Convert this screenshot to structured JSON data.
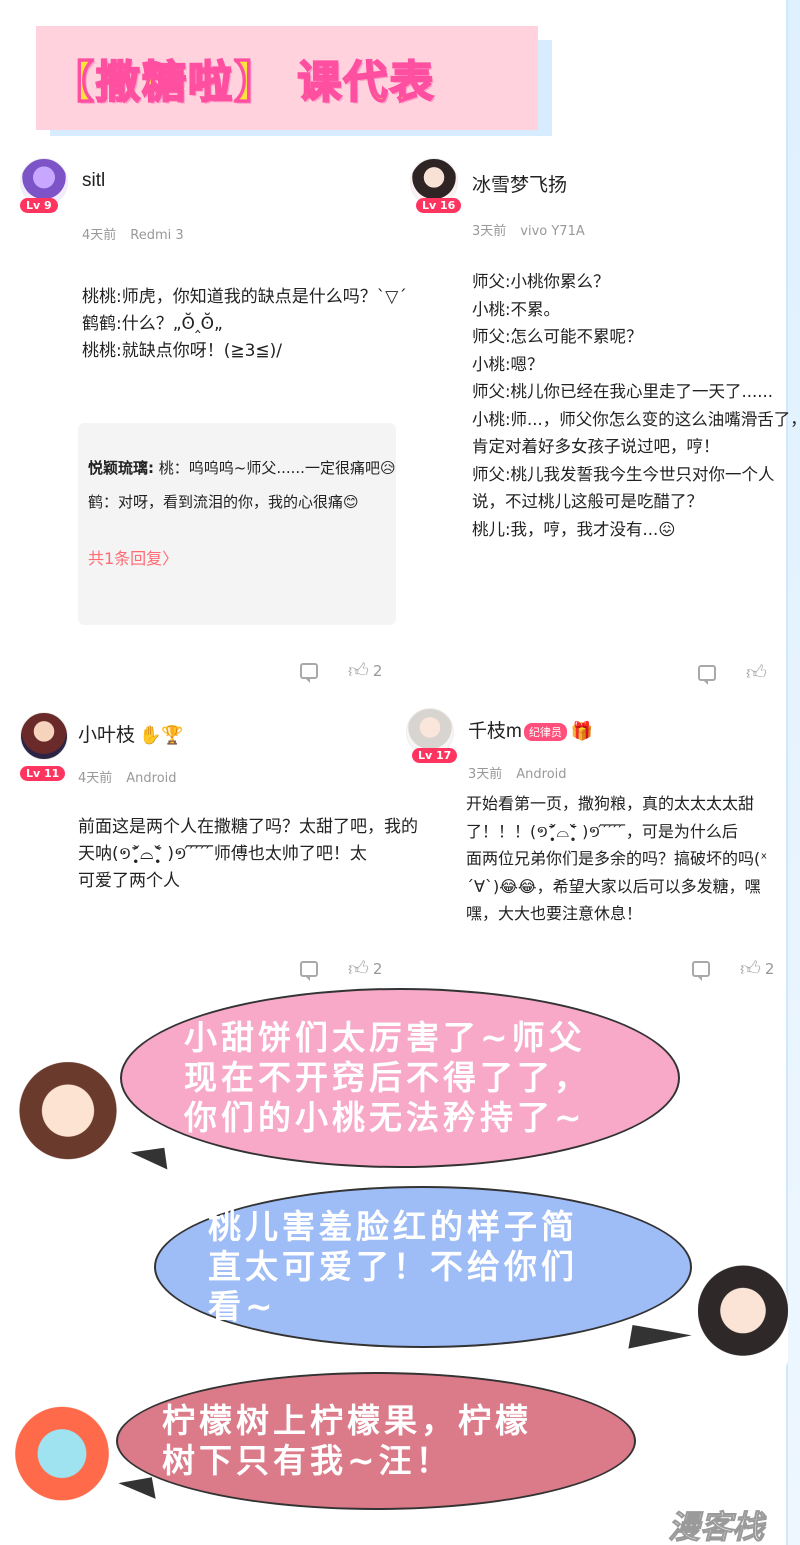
{
  "header": {
    "title": "【撒糖啦】 课代表"
  },
  "comments": [
    {
      "username": "sitl",
      "level": "Lv 9",
      "time": "4天前",
      "device": "Redmi 3",
      "lines": [
        "桃桃:师虎，你知道我的缺点是什么吗？`▽´",
        "鹤鹤:什么？„ʘ̆‸ʘ̆„",
        "桃桃:就缺点你呀！(≧3≦)/"
      ],
      "reply": {
        "author": "悦颖琉璃:",
        "line1": " 桃：呜呜呜~师父......一定很痛吧😥",
        "line2": "鹤：对呀，看到流泪的你，我的心很痛😊",
        "more": "共1条回复〉"
      },
      "likes": "2"
    },
    {
      "username": "冰雪梦飞扬",
      "level": "Lv 16",
      "time": "3天前",
      "device": "vivo Y71A",
      "lines": [
        "师父:小桃你累么？",
        "小桃:不累。",
        "师父:怎么可能不累呢？",
        "小桃:嗯？",
        "师父:桃儿你已经在我心里走了一天了......",
        "小桃:师...，师父你怎么变的这么油嘴滑舌了，",
        "肯定对着好多女孩子说过吧，哼！",
        "师父:桃儿我发誓我今生今世只对你一个人",
        "说，不过桃儿这般可是吃醋了？",
        "桃儿:我，哼，我才没有...😖"
      ],
      "likes": ""
    },
    {
      "username": "小叶枝",
      "level": "Lv 11",
      "time": "4天前",
      "device": "Android",
      "lines": [
        "前面这是两个人在撒糖了吗？太甜了吧，我的",
        "天呐(១˃̣̣̥᷄⌓˂̣̣̥᷅ )១ ᷇ ᷇ ᷇ ᷇ ᷇师傅也太帅了吧！太",
        "可爱了两个人"
      ],
      "likes": "2"
    },
    {
      "username": "千枝m",
      "vip": "纪律员",
      "level": "Lv 17",
      "time": "3天前",
      "device": "Android",
      "lines": [
        "开始看第一页，撒狗粮，真的太太太太甜",
        "了！！！(១˃̣̣̥᷄⌓˂̣̣̥᷅ )១ ᷇ ᷇ ᷇ ᷇ ᷇，可是为什么后",
        "面两位兄弟你们是多余的吗？搞破坏的吗(ˣ",
        "ˊ∀ˋ)😂😂，希望大家以后可以多发糖，嘿",
        "嘿，大大也要注意休息！"
      ],
      "likes": "2"
    }
  ],
  "bubbles": [
    {
      "lines": [
        "小甜饼们太厉害了~师父",
        "现在不开窍后不得了了，",
        "你们的小桃无法矜持了~"
      ],
      "color": "#f7a9c7"
    },
    {
      "lines": [
        "桃儿害羞脸红的样子简",
        "直太可爱了！不给你们",
        "看~"
      ],
      "color": "#9ebcf6"
    },
    {
      "lines": [
        "柠檬树上柠檬果，柠檬",
        "树下只有我~汪！"
      ],
      "color": "#db7a88"
    }
  ],
  "watermark": "漫客栈",
  "icons": {
    "comment": "comment-icon",
    "like": "thumbs-up-icon"
  }
}
